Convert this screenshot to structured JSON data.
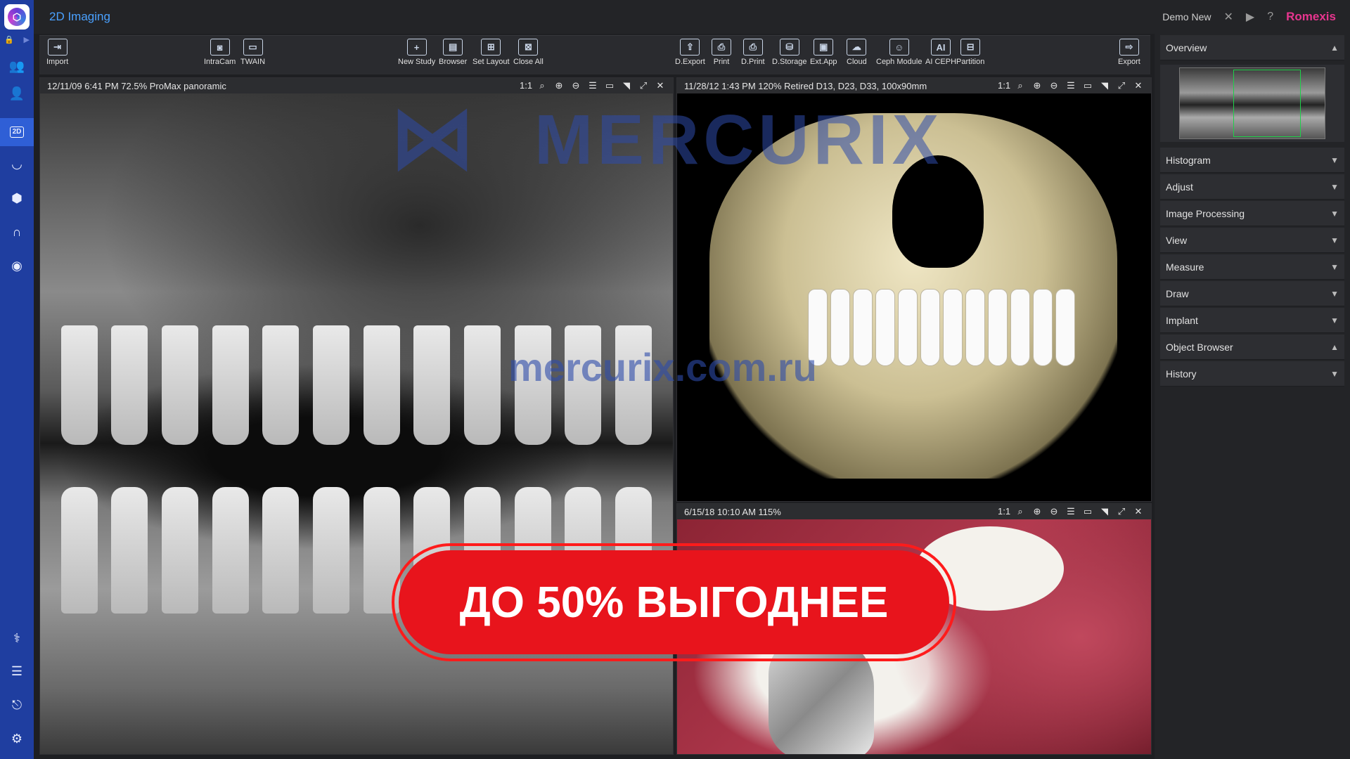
{
  "app": {
    "title": "2D Imaging",
    "user": "Demo New",
    "brand": "Romexis"
  },
  "toolbar": {
    "import": "Import",
    "intracam": "IntraCam",
    "twain": "TWAIN",
    "new_study": "New Study",
    "browser": "Browser",
    "set_layout": "Set Layout",
    "close_all": "Close All",
    "dexport": "D.Export",
    "print": "Print",
    "dprint": "D.Print",
    "dstorage": "D.Storage",
    "extapp": "Ext.App",
    "cloud": "Cloud",
    "ceph": "Ceph Module",
    "aiceph": "AI CEPH",
    "partition": "Partition",
    "export": "Export"
  },
  "viewports": {
    "pano": {
      "info": "12/11/09 6:41 PM   72.5%   ProMax panoramic",
      "scale": "1:1"
    },
    "cbct": {
      "info": "11/28/12 1:43 PM   120%   Retired D13, D23, D33, 100x90mm",
      "scale": "1:1"
    },
    "photo": {
      "info": "6/15/18 10:10 AM   115%",
      "scale": "1:1"
    }
  },
  "overlay": {
    "watermark": "MERCURIX",
    "url": "mercurix.com.ru",
    "banner": "ДО 50% ВЫГОДНЕЕ"
  },
  "panel": {
    "overview": "Overview",
    "histogram": "Histogram",
    "adjust": "Adjust",
    "image_processing": "Image Processing",
    "view": "View",
    "measure": "Measure",
    "draw": "Draw",
    "implant": "Implant",
    "object_browser": "Object Browser",
    "history": "History"
  },
  "colors": {
    "accent": "#4aa1ff",
    "rail": "#1f3ea0",
    "brand": "#e8358f",
    "banner": "#e8141c"
  }
}
